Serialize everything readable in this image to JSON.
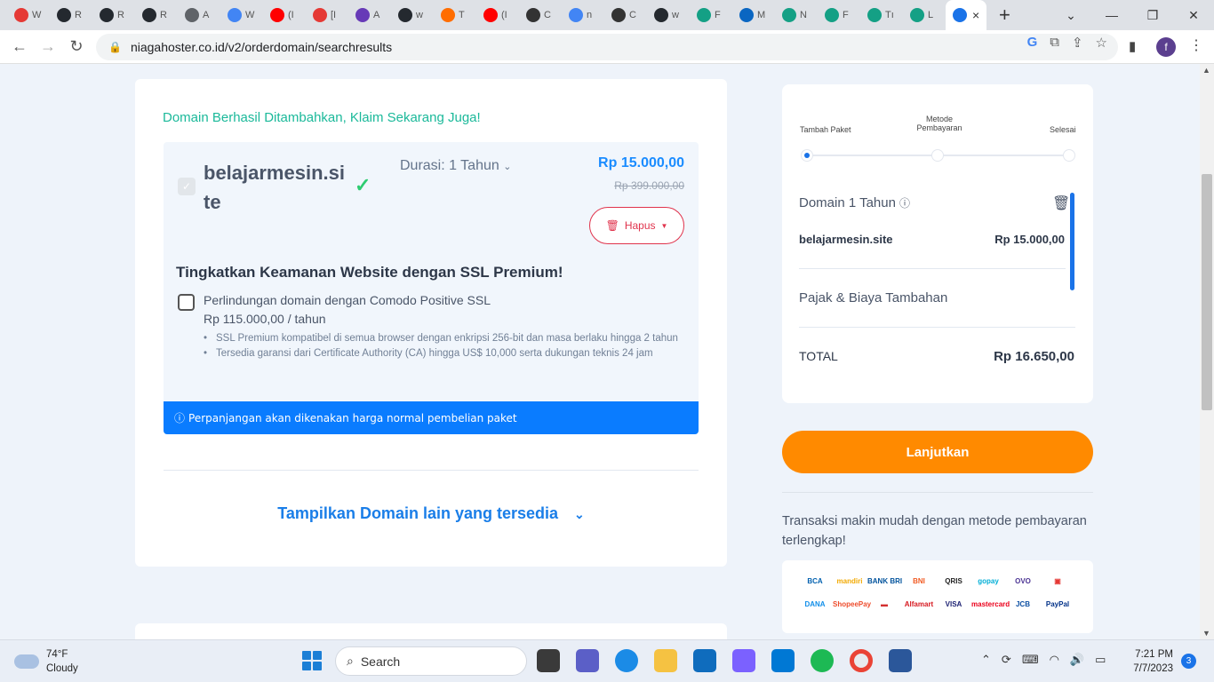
{
  "browser": {
    "tabs": [
      {
        "label": "W",
        "color": "#e53935"
      },
      {
        "label": "R",
        "color": "#24292f"
      },
      {
        "label": "R",
        "color": "#24292f"
      },
      {
        "label": "R",
        "color": "#24292f"
      },
      {
        "label": "A",
        "color": "#5f6368"
      },
      {
        "label": "W",
        "color": "#4285f4"
      },
      {
        "label": "(I",
        "color": "#ff0000"
      },
      {
        "label": "[I",
        "color": "#e53935"
      },
      {
        "label": "A",
        "color": "#673ab7"
      },
      {
        "label": "w",
        "color": "#24292f"
      },
      {
        "label": "T",
        "color": "#ff6d00"
      },
      {
        "label": "(I",
        "color": "#ff0000"
      },
      {
        "label": "C",
        "color": "#333333"
      },
      {
        "label": "n",
        "color": "#4285f4"
      },
      {
        "label": "C",
        "color": "#333333"
      },
      {
        "label": "w",
        "color": "#24292f"
      },
      {
        "label": "F",
        "color": "#14a085"
      },
      {
        "label": "M",
        "color": "#0a66c2"
      },
      {
        "label": "N",
        "color": "#14a085"
      },
      {
        "label": "F",
        "color": "#14a085"
      },
      {
        "label": "Tı",
        "color": "#14a085"
      },
      {
        "label": "L",
        "color": "#14a085"
      }
    ],
    "active_tab_close": "×",
    "new_tab": "+",
    "url": "niagahoster.co.id/v2/orderdomain/searchresults",
    "profile_initial": "f"
  },
  "page": {
    "success_message": "Domain Berhasil Ditambahkan, Klaim Sekarang Juga!",
    "domain": {
      "name": "belajarmesin.site",
      "duration": "Durasi: 1 Tahun",
      "price": "Rp 15.000,00",
      "old_price": "Rp 399.000,00",
      "delete_label": "Hapus"
    },
    "ssl": {
      "title": "Tingkatkan Keamanan Website dengan SSL Premium!",
      "option_label": "Perlindungan domain dengan Comodo Positive SSL",
      "option_price": "Rp 115.000,00 / tahun",
      "features": [
        "SSL Premium kompatibel di semua browser dengan enkripsi 256-bit dan masa berlaku hingga 2 tahun",
        "Tersedia garansi dari Certificate Authority (CA) hingga US$ 10,000 serta dukungan teknis 24 jam"
      ]
    },
    "renewal_notice": "Perpanjangan akan dikenakan harga normal pembelian paket",
    "more_domains": "Tampilkan Domain lain yang tersedia"
  },
  "summary": {
    "steps": [
      {
        "label": "Tambah Paket",
        "active": true
      },
      {
        "label": "Metode Pembayaran",
        "active": false
      },
      {
        "label": "Selesai",
        "active": false
      }
    ],
    "section_title": "Domain 1 Tahun",
    "item_name": "belajarmesin.site",
    "item_price": "Rp 15.000,00",
    "tax_label": "Pajak & Biaya Tambahan",
    "total_label": "TOTAL",
    "total_value": "Rp 16.650,00",
    "continue_label": "Lanjutkan",
    "payment_text": "Transaksi makin mudah dengan metode pembayaran terlengkap!",
    "payment_methods": [
      {
        "label": "BCA",
        "color": "#0060af"
      },
      {
        "label": "mandiri",
        "color": "#f2a900"
      },
      {
        "label": "BANK BRI",
        "color": "#00529c"
      },
      {
        "label": "BNI",
        "color": "#f15a22"
      },
      {
        "label": "QRIS",
        "color": "#222222"
      },
      {
        "label": "gopay",
        "color": "#00aed6"
      },
      {
        "label": "OVO",
        "color": "#4c3494"
      },
      {
        "label": "▣",
        "color": "#e53935"
      },
      {
        "label": "DANA",
        "color": "#108ee9"
      },
      {
        "label": "ShopeePay",
        "color": "#ee4d2d"
      },
      {
        "label": "▬",
        "color": "#d32f2f"
      },
      {
        "label": "Alfamart",
        "color": "#d71920"
      },
      {
        "label": "VISA",
        "color": "#1a1f71"
      },
      {
        "label": "mastercard",
        "color": "#eb001b"
      },
      {
        "label": "JCB",
        "color": "#0b4ea2"
      },
      {
        "label": "PayPal",
        "color": "#003087"
      }
    ]
  },
  "taskbar": {
    "temperature": "74°F",
    "weather": "Cloudy",
    "search_placeholder": "Search",
    "time": "7:21 PM",
    "date": "7/7/2023",
    "notifications": "3"
  }
}
